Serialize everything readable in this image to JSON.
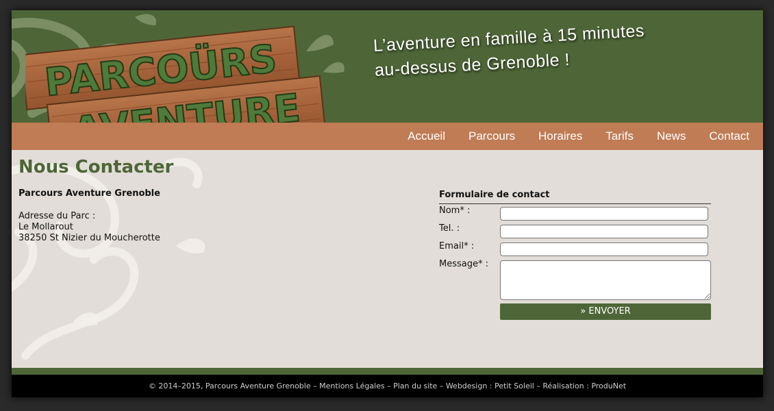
{
  "header": {
    "logo_line1": "PARCOÜRS",
    "logo_line2": "AVENTURE",
    "tagline_line1": "L’aventure en famille à 15 minutes",
    "tagline_line2": "au-dessus de Grenoble !"
  },
  "nav": {
    "items": [
      {
        "label": "Accueil"
      },
      {
        "label": "Parcours"
      },
      {
        "label": "Horaires"
      },
      {
        "label": "Tarifs"
      },
      {
        "label": "News"
      },
      {
        "label": "Contact"
      }
    ]
  },
  "content": {
    "title": "Nous Contacter",
    "org_name": "Parcours Aventure Grenoble",
    "address_label": "Adresse du Parc :",
    "address_line1": "Le Mollarout",
    "address_line2": "38250 St Nizier du Moucherotte"
  },
  "form": {
    "title": "Formulaire de contact",
    "name_label": "Nom* :",
    "name_value": "",
    "tel_label": "Tel. :",
    "tel_value": "",
    "email_label": "Email* :",
    "email_value": "",
    "message_label": "Message* :",
    "message_value": "",
    "submit_label": "» ENVOYER"
  },
  "footer": {
    "text": "© 2014–2015, Parcours Aventure Grenoble – Mentions Légales – Plan du site – Webdesign : Petit Soleil – Réalisation : ProduNet"
  },
  "colors": {
    "header_green": "#4e6637",
    "nav_orange": "#bf7c55",
    "content_bg": "#e2ddd8",
    "wood": "#a9663e"
  }
}
